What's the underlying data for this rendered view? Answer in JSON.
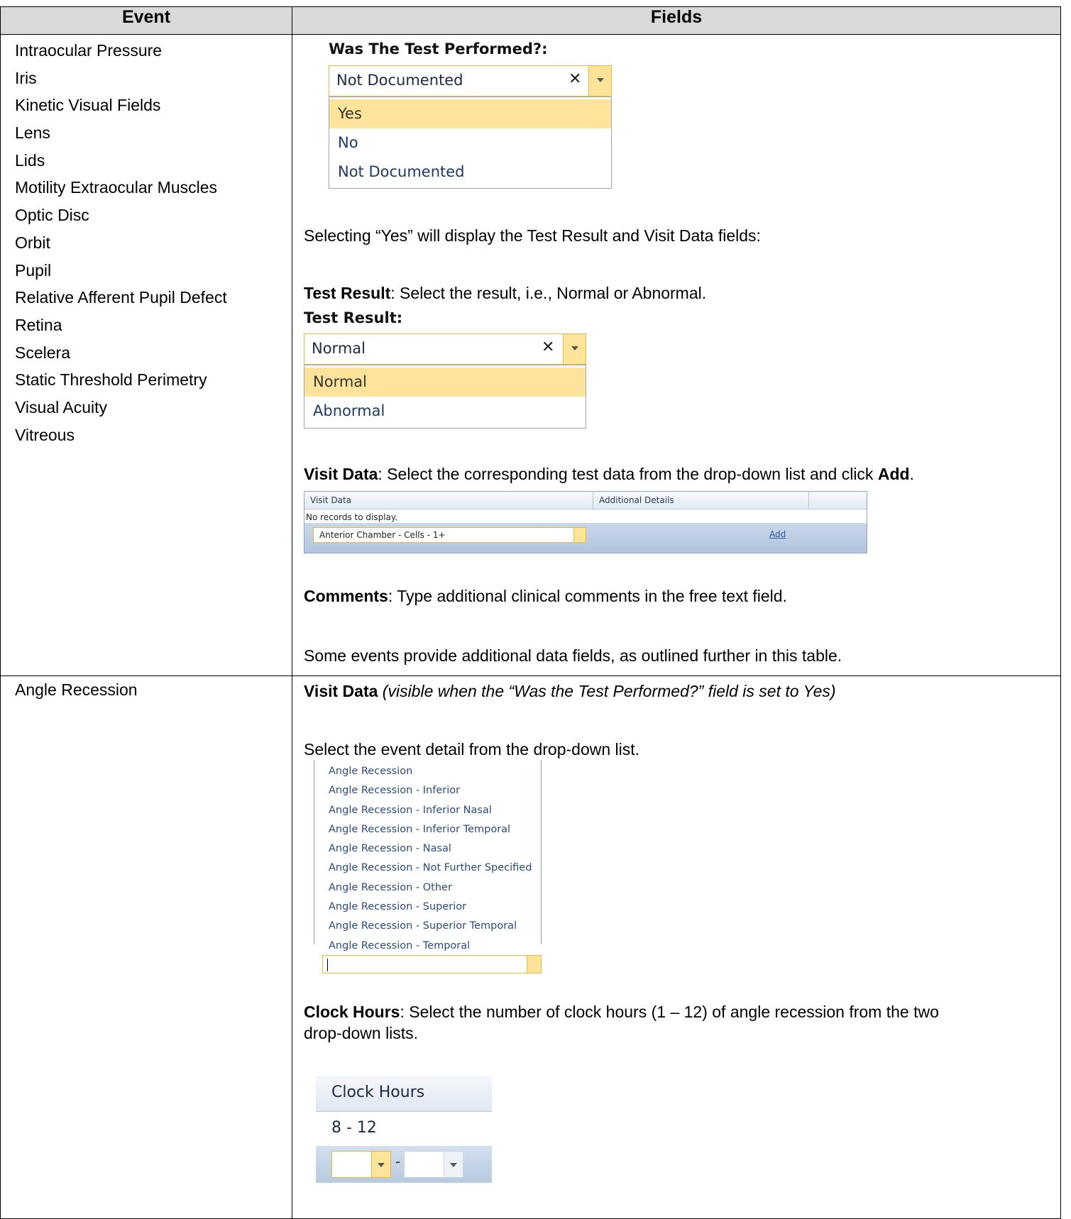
{
  "table": {
    "header": {
      "event": "Event",
      "fields": "Fields"
    },
    "row1": {
      "events": [
        "Intraocular Pressure",
        "Iris",
        "Kinetic Visual Fields",
        "Lens",
        "Lids",
        "Motility Extraocular Muscles",
        "Optic Disc",
        "Orbit",
        "Pupil",
        "Relative Afferent Pupil Defect",
        "Retina",
        "Scelera",
        "Static Threshold Perimetry",
        "Visual Acuity",
        "Vitreous"
      ],
      "test_performed": {
        "label": "Was The Test Performed?:",
        "value": "Not Documented",
        "clear_glyph": "✕",
        "options": [
          "Yes",
          "No",
          "Not Documented"
        ]
      },
      "selecting_yes": "Selecting “Yes” will display the Test Result and Visit Data fields:",
      "test_result_desc_bold": "Test Result",
      "test_result_desc": ": Select the result, i.e., Normal or Abnormal.",
      "test_result": {
        "label": "Test Result:",
        "value": "Normal",
        "clear_glyph": "✕",
        "options": [
          "Normal",
          "Abnormal"
        ]
      },
      "visit_data_bold": "Visit Data",
      "visit_data_desc": ": Select the corresponding test data from the drop-down list and click ",
      "visit_data_add_bold": "Add",
      "visit_data_period": ".",
      "grid": {
        "col_visit_data": "Visit Data",
        "col_additional": "Additional Details",
        "no_records": "No records to display.",
        "selected": "Anterior Chamber - Cells - 1+",
        "add_link": "Add"
      },
      "comments_bold": "Comments",
      "comments_desc": ": Type additional clinical comments in the free text field.",
      "some_events": "Some events provide additional data fields, as outlined further in this table."
    },
    "row2": {
      "event": "Angle Recession",
      "visit_data_bold": "Visit Data",
      "visit_data_italic": "(visible when the “Was the Test Performed?” field is set to Yes)",
      "select_detail": "Select the event detail from the drop-down list.",
      "angle_options": [
        "Angle Recession",
        "Angle Recession - Inferior",
        "Angle Recession - Inferior Nasal",
        "Angle Recession - Inferior Temporal",
        "Angle Recession - Nasal",
        "Angle Recession - Not Further Specified",
        "Angle Recession - Other",
        "Angle Recession - Superior",
        "Angle Recession - Superior Temporal",
        "Angle Recession - Temporal"
      ],
      "clock_hours_bold": "Clock Hours",
      "clock_hours_desc": ": Select the number of clock hours (1 – 12) of angle recession from the two",
      "clock_hours_desc2": "drop-down lists.",
      "clock": {
        "header": "Clock Hours",
        "value": "8 - 12",
        "separator": "-"
      }
    }
  },
  "colors": {
    "accent_yellow": "#fde49a",
    "border_yellow": "#e6b840",
    "grid_blue": "#b2c5de",
    "link_blue": "#2a56a0"
  }
}
